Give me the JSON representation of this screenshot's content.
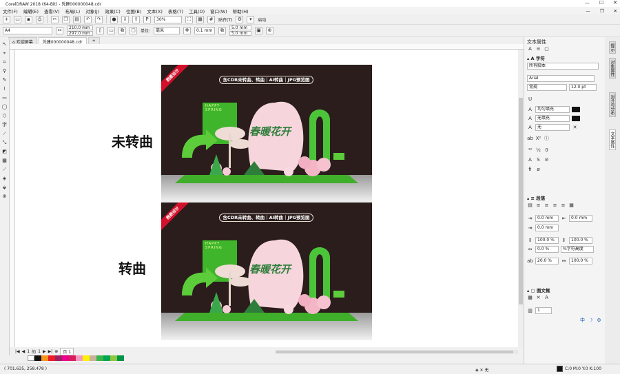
{
  "title": "CorelDRAW 2018 (64-Bit) - 凭建000000048.cdr",
  "menu": [
    "文件(F)",
    "编辑(E)",
    "查看(V)",
    "布局(L)",
    "对象(J)",
    "效果(C)",
    "位图(B)",
    "文本(X)",
    "表格(T)",
    "工具(O)",
    "窗口(W)",
    "帮助(H)"
  ],
  "toolbar1": {
    "zoom": "30%",
    "snap": "贴齐(T)",
    "launch": "启动"
  },
  "toolbar2": {
    "page_size": "A4",
    "width": "210.0 mm",
    "height": "297.0 mm",
    "units_label": "单位:",
    "units": "毫米",
    "nudge": "0.1 mm",
    "dup_x": "5.0 mm",
    "dup_y": "5.0 mm"
  },
  "doc_tabs": [
    "欢迎屏幕",
    "凭建000000048.cdr"
  ],
  "canvas": {
    "label_top": "未转曲",
    "label_bottom": "转曲"
  },
  "poster": {
    "ribbon": "鼎鼎设计",
    "pill": "含CDR未转曲、转曲｜AI转曲｜JPG预览图",
    "happy_1": "HAPPY",
    "happy_2": "SPRING",
    "title": "春暖花开"
  },
  "page_nav": {
    "current": "1",
    "of": "的",
    "total": "1",
    "page_tab": "页 1"
  },
  "status": {
    "coords": "( 701.635, 258.478 )",
    "fill": "无",
    "cmyk": "C:0 M:0 Y:0 K:100"
  },
  "dock": {
    "title": "文本属性",
    "char_section": "字符",
    "script": "所有脚本",
    "font": "Arial",
    "style": "常规",
    "size": "12.0 pt",
    "fill_type": "均匀填充",
    "bg_fill": "无填充",
    "outline": "无",
    "para_section": "段落",
    "indent_left": "0.0 mm",
    "indent_right": "0.0 mm",
    "indent_first": "0.0 mm",
    "line_spacing": "100.0 %",
    "para_before": "100.0 %",
    "char_spacing": "0.0 %",
    "spacing_unit": "%字符高度",
    "word_spacing": "20.0 %",
    "lang_spacing": "100.0 %",
    "frame_section": "图文框",
    "columns": "1"
  },
  "side_tabs": [
    "提示",
    "对象属性",
    "对齐与分布",
    "文本属性"
  ],
  "colors": {
    "accent": "#2f9e44",
    "ribbon": "#d3102b",
    "poster_bg": "#2a1d1c"
  }
}
